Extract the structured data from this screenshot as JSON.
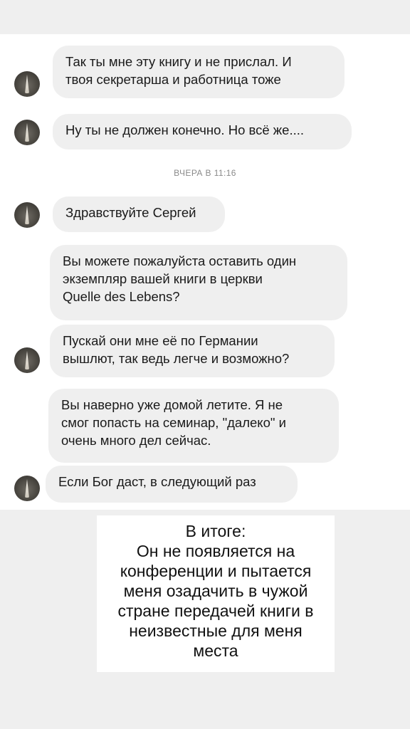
{
  "chat": {
    "messages": [
      {
        "lines": [
          "Так ты мне эту книгу и не прислал. И",
          "твоя секретарша и работница тоже"
        ]
      },
      {
        "lines": [
          "Ну ты не должен конечно. Но всё же...."
        ]
      },
      {
        "lines": [
          "Здравствуйте Сергей"
        ]
      },
      {
        "lines": [
          "Вы можете пожалуйста оставить один",
          "экземпляр вашей книги в церкви",
          "Quelle des Lebens?"
        ]
      },
      {
        "lines": [
          "Пускай они мне её по Германии",
          "вышлют, так ведь легче и возможно?"
        ]
      },
      {
        "lines": [
          "Вы наверно уже домой летите. Я не",
          "смог попасть на семинар, \"далеко\" и",
          "очень много дел сейчас."
        ]
      },
      {
        "lines": [
          "Если Бог даст, в следующий раз"
        ]
      }
    ],
    "timestamp": "ВЧЕРА В 11:16"
  },
  "caption": {
    "title": "В итоге:",
    "body": "Он не появляется на\nконференции и пытается\nменя озадачить в чужой\nстране передачей книги в\nнеизвестные для меня\nместа"
  }
}
